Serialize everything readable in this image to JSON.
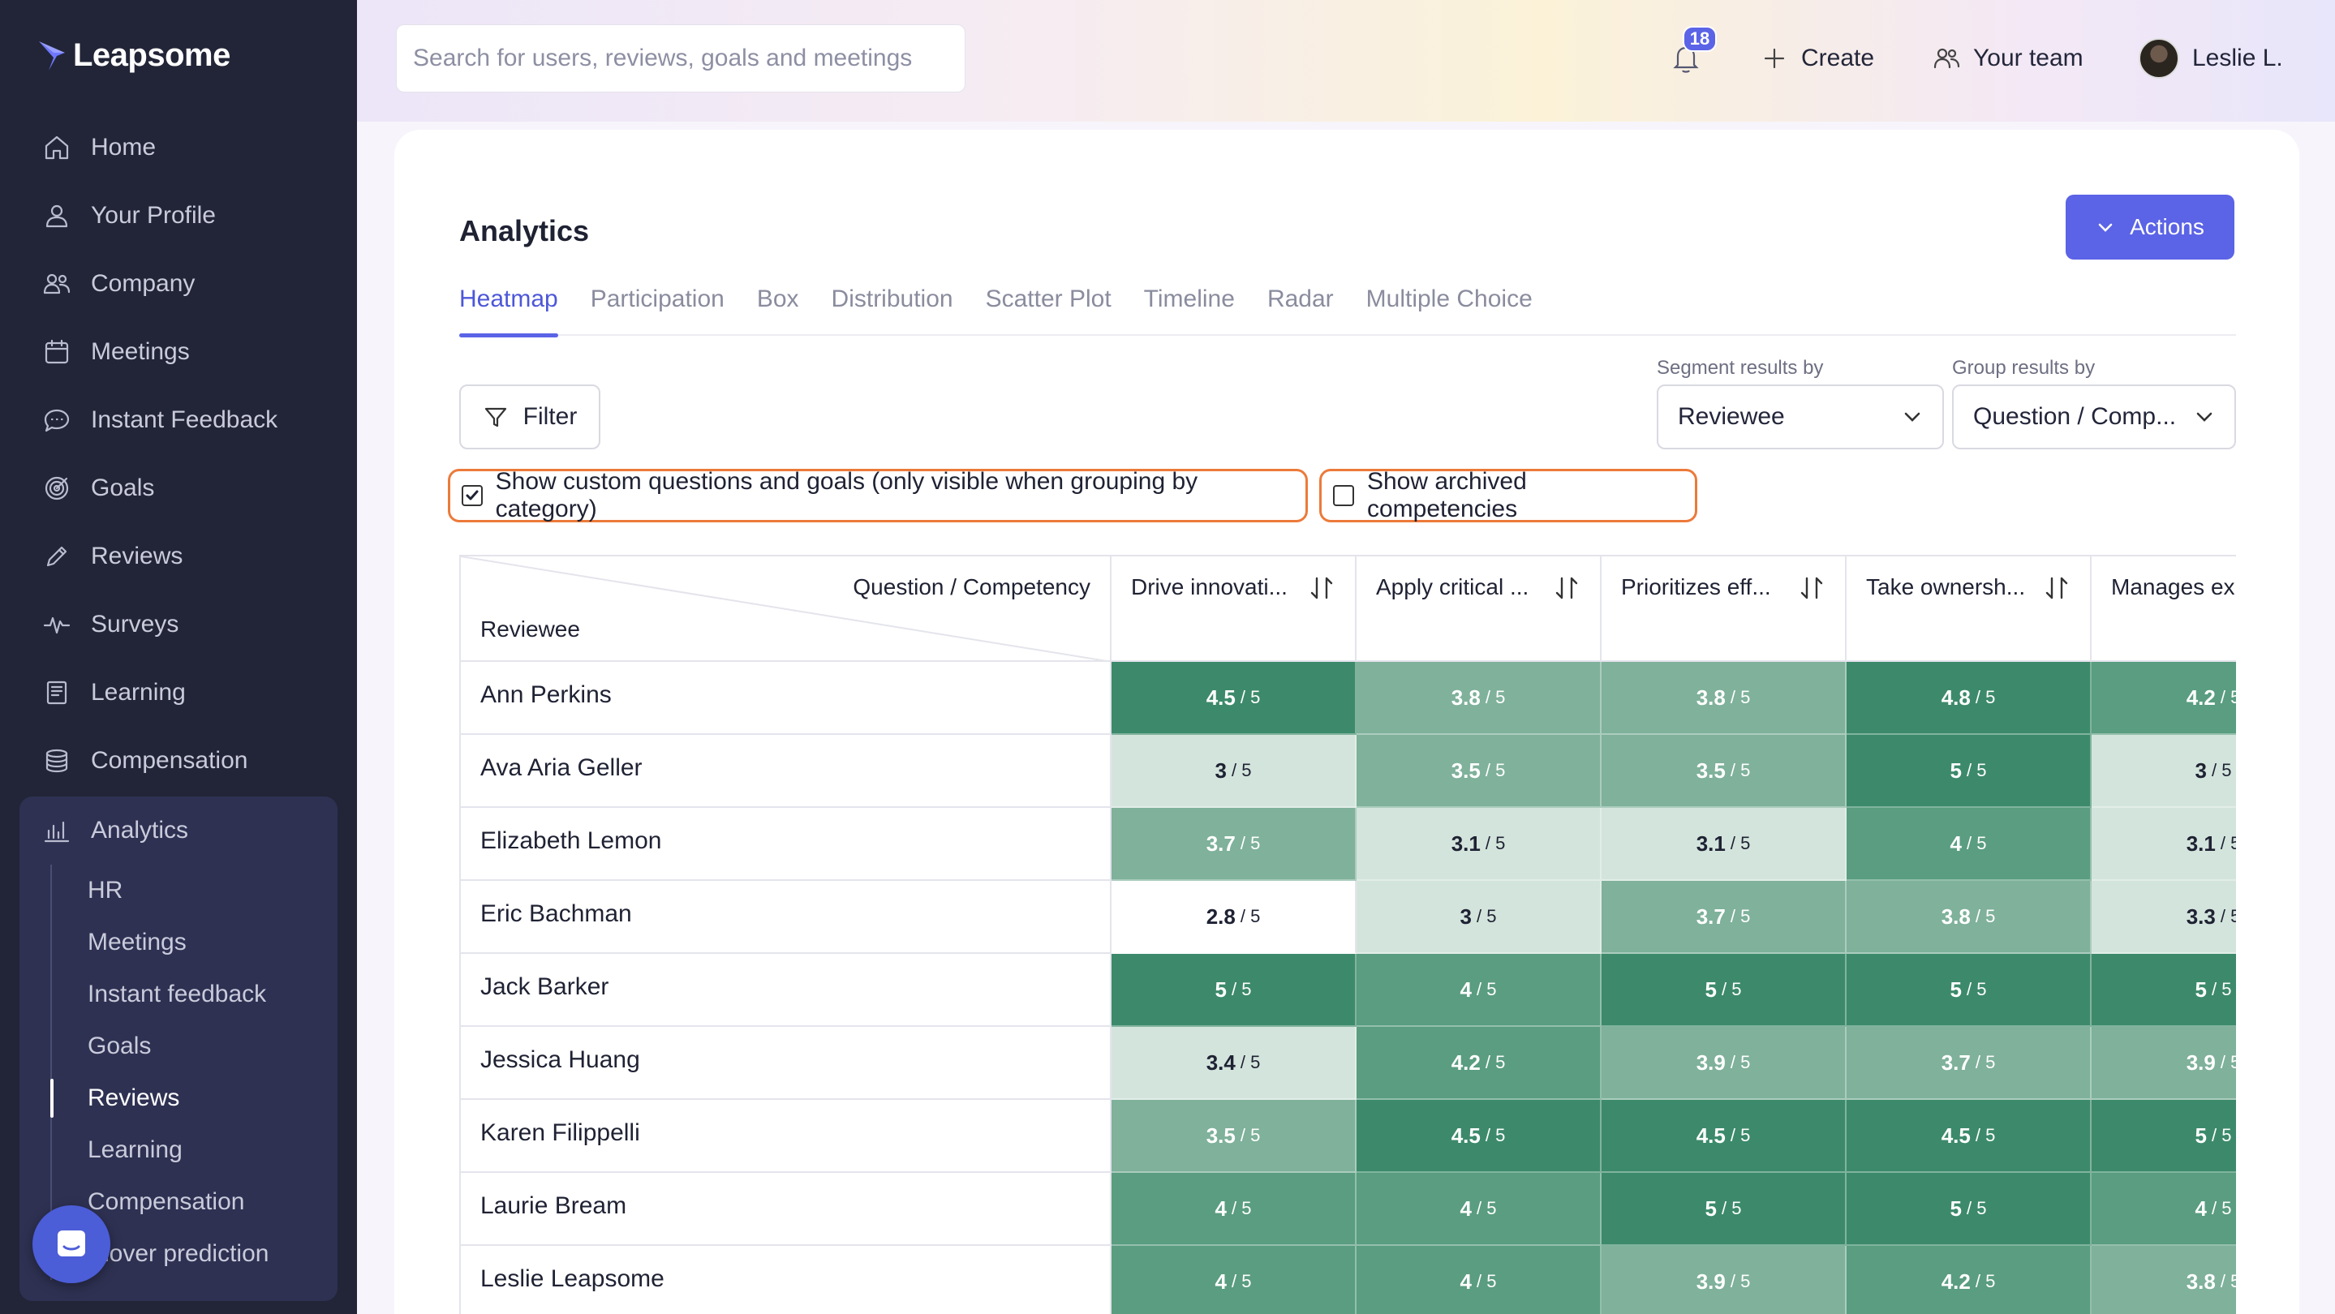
{
  "brand": {
    "name": "Leapsome"
  },
  "nav": {
    "items": [
      {
        "label": "Home",
        "icon": "home-icon"
      },
      {
        "label": "Your Profile",
        "icon": "user-icon"
      },
      {
        "label": "Company",
        "icon": "users-icon"
      },
      {
        "label": "Meetings",
        "icon": "calendar-icon"
      },
      {
        "label": "Instant Feedback",
        "icon": "chat-icon"
      },
      {
        "label": "Goals",
        "icon": "target-icon"
      },
      {
        "label": "Reviews",
        "icon": "pencil-icon"
      },
      {
        "label": "Surveys",
        "icon": "pulse-icon"
      },
      {
        "label": "Learning",
        "icon": "book-icon"
      },
      {
        "label": "Compensation",
        "icon": "coins-icon"
      }
    ],
    "analytics": {
      "label": "Analytics",
      "icon": "bar-chart-icon",
      "sub_items": [
        "HR",
        "Meetings",
        "Instant feedback",
        "Goals",
        "Reviews",
        "Learning",
        "Compensation",
        "Turnover prediction"
      ],
      "active_sub_item": "Reviews",
      "visible_turnover_text": "rnover prediction"
    }
  },
  "topbar": {
    "search_placeholder": "Search for users, reviews, goals and meetings",
    "notification_count": "18",
    "create_label": "Create",
    "team_label": "Your team",
    "user_name": "Leslie L."
  },
  "page": {
    "title": "Analytics",
    "actions_label": "Actions",
    "tabs": [
      "Heatmap",
      "Participation",
      "Box",
      "Distribution",
      "Scatter Plot",
      "Timeline",
      "Radar",
      "Multiple Choice"
    ],
    "active_tab": "Heatmap",
    "filter_label": "Filter",
    "segment_label": "Segment results by",
    "segment_value": "Reviewee",
    "group_label": "Group results by",
    "group_value": "Question / Comp...",
    "checkbox_custom": {
      "label": "Show custom questions and goals (only visible when grouping by category)",
      "checked": true
    },
    "checkbox_archived": {
      "label": "Show archived competencies",
      "checked": false
    }
  },
  "heatmap": {
    "corner_top": "Question / Competency",
    "corner_bottom": "Reviewee",
    "columns": [
      "Drive innovati...",
      "Apply critical ...",
      "Prioritizes eff...",
      "Take ownersh...",
      "Manages ex"
    ],
    "denominator": "/ 5",
    "rows": [
      {
        "name": "Ann Perkins",
        "values": [
          "4.5",
          "3.8",
          "3.8",
          "4.8",
          "4.2"
        ]
      },
      {
        "name": "Ava Aria Geller",
        "values": [
          "3",
          "3.5",
          "3.5",
          "5",
          "3"
        ]
      },
      {
        "name": "Elizabeth Lemon",
        "values": [
          "3.7",
          "3.1",
          "3.1",
          "4",
          "3.1"
        ]
      },
      {
        "name": "Eric Bachman",
        "values": [
          "2.8",
          "3",
          "3.7",
          "3.8",
          "3.3"
        ]
      },
      {
        "name": "Jack Barker",
        "values": [
          "5",
          "4",
          "5",
          "5",
          "5"
        ]
      },
      {
        "name": "Jessica Huang",
        "values": [
          "3.4",
          "4.2",
          "3.9",
          "3.7",
          "3.9"
        ]
      },
      {
        "name": "Karen Filippelli",
        "values": [
          "3.5",
          "4.5",
          "4.5",
          "4.5",
          "5"
        ]
      },
      {
        "name": "Laurie Bream",
        "values": [
          "4",
          "4",
          "5",
          "5",
          "4"
        ]
      },
      {
        "name": "Leslie Leapsome",
        "values": [
          "4",
          "4",
          "3.9",
          "4.2",
          "3.8"
        ]
      }
    ],
    "colors": {
      "white": "#ffffff",
      "light": "#d3e4dc",
      "mid": "#7fb19b",
      "strong": "#5a9d80",
      "dark": "#3c8a6b"
    }
  },
  "accent_color": "#5b63e6",
  "highlight_color": "#ec7a3a"
}
